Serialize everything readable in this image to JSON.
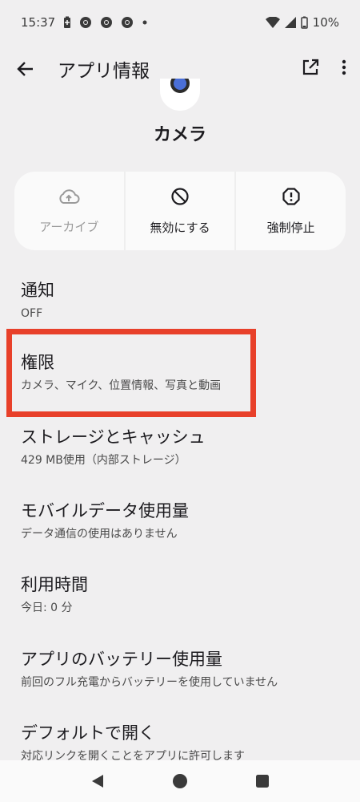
{
  "status_bar": {
    "time": "15:37",
    "battery_percent": "10%",
    "icons": [
      "battery-saver-icon",
      "chrome-icon",
      "chrome-icon",
      "chrome-icon",
      "more-dot-icon",
      "wifi-icon",
      "signal-icon",
      "battery-icon"
    ]
  },
  "app_bar": {
    "title": "アプリ情報",
    "icons": [
      "back-arrow-icon",
      "open-external-icon",
      "more-vert-icon"
    ]
  },
  "app": {
    "name": "カメラ"
  },
  "actions": [
    {
      "label": "アーカイブ",
      "icon": "cloud-upload-icon",
      "enabled": false
    },
    {
      "label": "無効にする",
      "icon": "block-icon",
      "enabled": true
    },
    {
      "label": "強制停止",
      "icon": "alert-octagon-icon",
      "enabled": true
    }
  ],
  "settings": [
    {
      "title": "通知",
      "subtitle": "OFF"
    },
    {
      "title": "権限",
      "subtitle": "カメラ、マイク、位置情報、写真と動画"
    },
    {
      "title": "ストレージとキャッシュ",
      "subtitle": "429 MB使用（内部ストレージ）"
    },
    {
      "title": "モバイルデータ使用量",
      "subtitle": "データ通信の使用はありません"
    },
    {
      "title": "利用時間",
      "subtitle": "今日: 0 分"
    },
    {
      "title": "アプリのバッテリー使用量",
      "subtitle": "前回のフル充電からバッテリーを使用していません"
    },
    {
      "title": "デフォルトで開く",
      "subtitle": "対応リンクを開くことをアプリに許可します"
    }
  ],
  "colors": {
    "background": "#f0eff0",
    "card": "#fafafa",
    "highlight": "#e8402a",
    "text_primary": "#1c1b1f",
    "text_secondary": "#4a4a4a",
    "disabled": "#9a9a9a"
  },
  "nav_bar": {
    "icons": [
      "nav-back-icon",
      "nav-home-icon",
      "nav-recents-icon"
    ]
  }
}
